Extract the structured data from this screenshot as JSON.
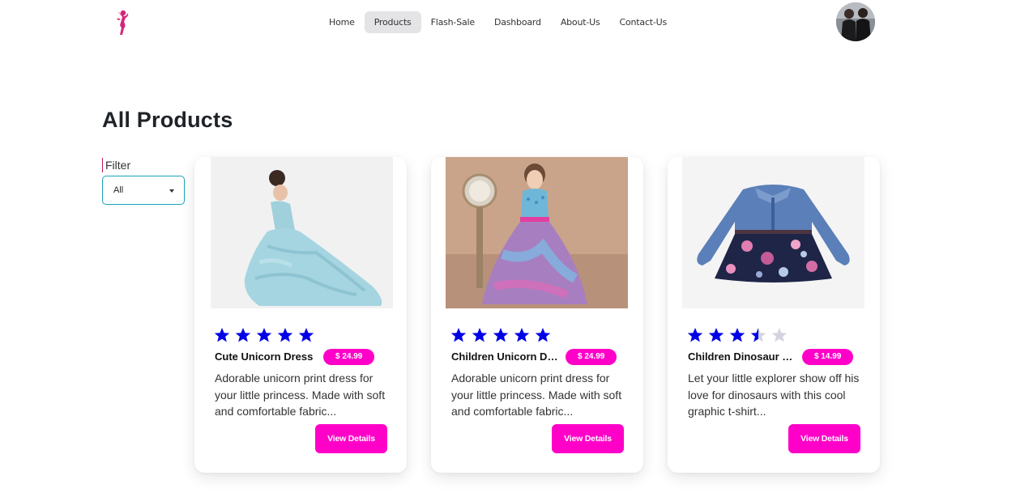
{
  "nav": {
    "items": [
      {
        "label": "Home"
      },
      {
        "label": "Products",
        "active": true
      },
      {
        "label": "Flash-Sale"
      },
      {
        "label": "Dashboard"
      },
      {
        "label": "About-Us"
      },
      {
        "label": "Contact-Us"
      }
    ]
  },
  "page": {
    "title": "All Products"
  },
  "filter": {
    "label": "Filter",
    "value": "All"
  },
  "colors": {
    "accent": "#ff00c8",
    "star": "#0000e6",
    "filter_border": "#1aa3b8"
  },
  "products": [
    {
      "title": "Cute Unicorn Dress",
      "price": "$ 24.99",
      "rating": 5,
      "description": "Adorable unicorn print dress for your little princess. Made with soft and comfortable fabric...",
      "button": "View Details"
    },
    {
      "title": "Children Unicorn Dress",
      "price": "$ 24.99",
      "rating": 5,
      "description": "Adorable unicorn print dress for your little princess. Made with soft and comfortable fabric...",
      "button": "View Details"
    },
    {
      "title": "Children Dinosaur T-Shirt",
      "price": "$ 14.99",
      "rating": 3.5,
      "description": "Let your little explorer show off his love for dinosaurs with this cool graphic t-shirt...",
      "button": "View Details"
    }
  ]
}
